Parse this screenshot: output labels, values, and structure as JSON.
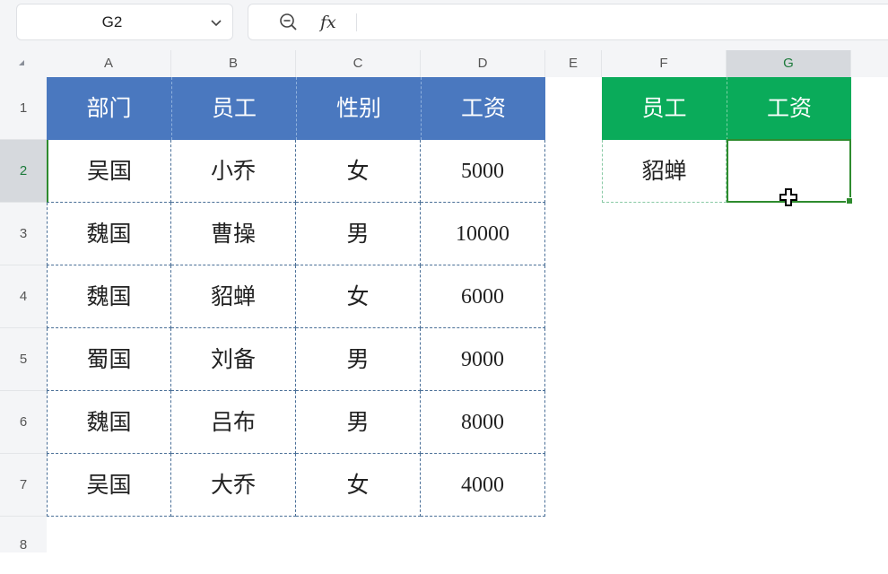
{
  "namebox": {
    "cell_ref": "G2",
    "dropdown_icon": "chevron-down-icon"
  },
  "formula_bar": {
    "zoom_icon": "zoom-out-icon",
    "fx_label": "fx",
    "content": ""
  },
  "columns": [
    "A",
    "B",
    "C",
    "D",
    "E",
    "F",
    "G"
  ],
  "rows": [
    "1",
    "2",
    "3",
    "4",
    "5",
    "6",
    "7",
    "8"
  ],
  "active_cell": {
    "column": "G",
    "row": "2"
  },
  "table": {
    "headers": [
      "部门",
      "员工",
      "性别",
      "工资"
    ],
    "rows": [
      [
        "吴国",
        "小乔",
        "女",
        "5000"
      ],
      [
        "魏国",
        "曹操",
        "男",
        "10000"
      ],
      [
        "魏国",
        "貂蝉",
        "女",
        "6000"
      ],
      [
        "蜀国",
        "刘备",
        "男",
        "9000"
      ],
      [
        "魏国",
        "吕布",
        "男",
        "8000"
      ],
      [
        "吴国",
        "大乔",
        "女",
        "4000"
      ]
    ]
  },
  "lookup": {
    "headers": [
      "员工",
      "工资"
    ],
    "row": [
      "貂蝉",
      ""
    ]
  },
  "colors": {
    "table_header": "#4a78bf",
    "lookup_header": "#0aab5a",
    "selection": "#2e8b2e"
  }
}
